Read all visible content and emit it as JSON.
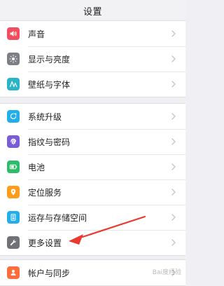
{
  "header": {
    "title": "设置"
  },
  "sections": [
    {
      "items": [
        {
          "label": "声音",
          "icon": "speaker-icon",
          "color": "#f44b5f"
        },
        {
          "label": "显示与亮度",
          "icon": "brightness-icon",
          "color": "#7d7f86"
        },
        {
          "label": "壁纸与字体",
          "icon": "font-icon",
          "color": "#27b5c7"
        }
      ]
    },
    {
      "items": [
        {
          "label": "系统升级",
          "icon": "system-update-icon",
          "color": "#22aeea"
        },
        {
          "label": "指纹与密码",
          "icon": "fingerprint-icon",
          "color": "#7a5dd6"
        },
        {
          "label": "电池",
          "icon": "battery-icon",
          "color": "#2dbc68"
        },
        {
          "label": "定位服务",
          "icon": "location-icon",
          "color": "#ff9c1a"
        },
        {
          "label": "运存与存储空间",
          "icon": "storage-icon",
          "color": "#22aeea"
        },
        {
          "label": "更多设置",
          "icon": "wrench-icon",
          "color": "#707277"
        }
      ]
    },
    {
      "items": [
        {
          "label": "帐户与同步",
          "icon": "account-icon",
          "color": "#ff6c3b"
        }
      ]
    }
  ],
  "watermark": "Bai度经验"
}
